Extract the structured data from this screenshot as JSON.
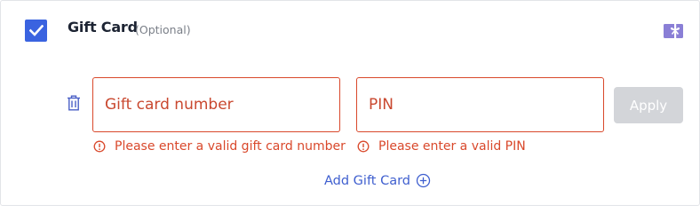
{
  "section": {
    "title": "Gift Card",
    "optional_label": "(Optional)",
    "checked": true
  },
  "icons": {
    "checkbox": "checkmark-icon",
    "header": "gift-icon",
    "remove": "trash-icon",
    "error": "info-circle-icon",
    "add": "plus-circle-icon"
  },
  "form": {
    "gift_card_number": {
      "placeholder": "Gift card number",
      "value": ""
    },
    "pin": {
      "placeholder": "PIN",
      "value": ""
    },
    "apply_label": "Apply",
    "apply_enabled": false
  },
  "errors": {
    "gift_card_number": "Please enter a valid gift card number",
    "pin": "Please enter a valid PIN"
  },
  "add_link": {
    "label": "Add Gift Card"
  },
  "colors": {
    "accent": "#3a63e0",
    "error": "#d9482b",
    "link": "#3f5fcf",
    "icon_purple": "#8a7fd6",
    "disabled_bg": "#d3d5d9",
    "disabled_text": "#ffffff"
  }
}
